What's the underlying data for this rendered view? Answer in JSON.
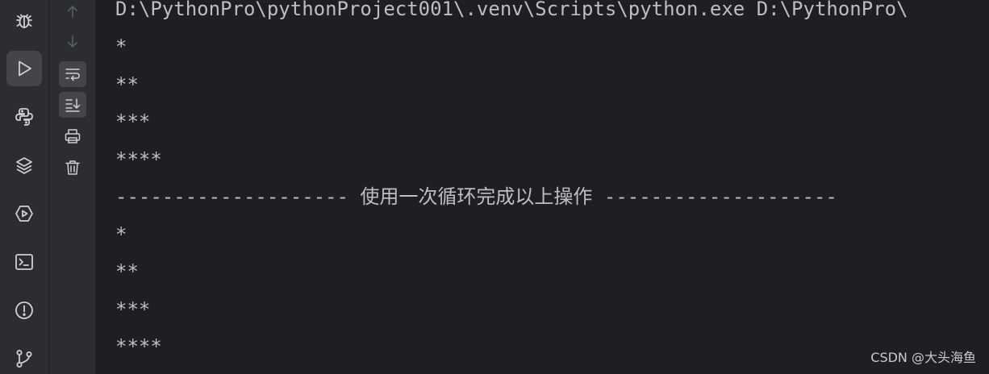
{
  "stripe": {
    "items": [
      {
        "icon": "debug-icon",
        "active": false
      },
      {
        "icon": "run-icon",
        "active": true
      },
      {
        "icon": "python-console-icon",
        "active": false
      },
      {
        "icon": "python-packages-icon",
        "active": false
      },
      {
        "icon": "services-icon",
        "active": false
      },
      {
        "icon": "terminal-icon",
        "active": false
      },
      {
        "icon": "problems-icon",
        "active": false
      },
      {
        "icon": "git-icon",
        "active": false
      }
    ]
  },
  "toolbar": {
    "items": [
      {
        "icon": "arrow-up-icon",
        "enabled": false
      },
      {
        "icon": "arrow-down-icon",
        "enabled": false
      },
      {
        "icon": "soft-wrap-icon",
        "toggled": true
      },
      {
        "icon": "scroll-to-end-icon",
        "toggled": true
      },
      {
        "icon": "print-icon"
      },
      {
        "icon": "trash-icon"
      }
    ]
  },
  "console": {
    "lines": [
      "D:\\PythonPro\\pythonProject001\\.venv\\Scripts\\python.exe D:\\PythonPro\\",
      "*",
      "**",
      "***",
      "****",
      "-------------------- 使用一次循环完成以上操作 --------------------",
      "*",
      "**",
      "***",
      "****"
    ]
  },
  "watermark": "CSDN @大头海鱼",
  "colors": {
    "background": "#1e1f22",
    "panel": "#2b2d30",
    "active": "#43454a",
    "text": "#bcbec4",
    "icon": "#ced0d6"
  }
}
